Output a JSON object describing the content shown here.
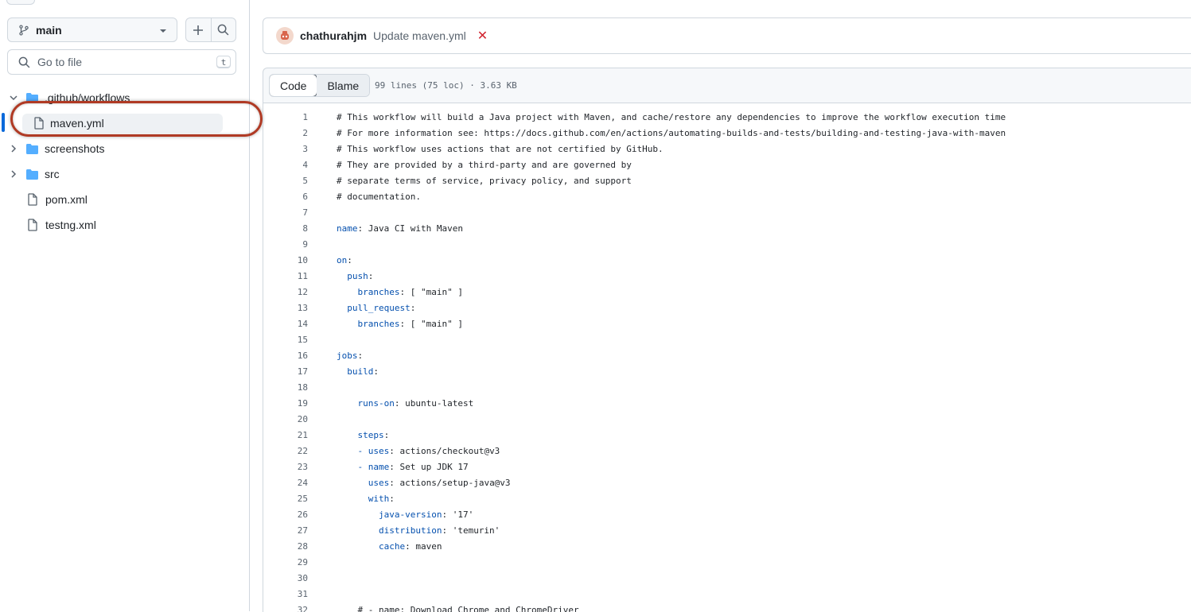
{
  "sidebar": {
    "branch": "main",
    "goto_placeholder": "Go to file",
    "goto_shortcut": "t",
    "tree": [
      {
        "label": ".github/workflows",
        "type": "folder",
        "expanded": true
      },
      {
        "label": "maven.yml",
        "type": "file",
        "selected": true
      },
      {
        "label": "screenshots",
        "type": "folder",
        "expanded": false
      },
      {
        "label": "src",
        "type": "folder",
        "expanded": false
      },
      {
        "label": "pom.xml",
        "type": "file"
      },
      {
        "label": "testng.xml",
        "type": "file"
      }
    ]
  },
  "commit": {
    "author": "chathurahjm",
    "message": "Update maven.yml",
    "status": "failed",
    "status_glyph": "✕"
  },
  "file_header": {
    "tabs": [
      "Code",
      "Blame"
    ],
    "active_tab": "Code",
    "info": "99 lines (75 loc) · 3.63 KB"
  },
  "code": [
    {
      "n": "1",
      "k": "",
      "v": "# This workflow will build a Java project with Maven, and cache/restore any dependencies to improve the workflow execution time"
    },
    {
      "n": "2",
      "k": "",
      "v": "# For more information see: https://docs.github.com/en/actions/automating-builds-and-tests/building-and-testing-java-with-maven"
    },
    {
      "n": "3",
      "k": "",
      "v": "# This workflow uses actions that are not certified by GitHub."
    },
    {
      "n": "4",
      "k": "",
      "v": "# They are provided by a third-party and are governed by"
    },
    {
      "n": "5",
      "k": "",
      "v": "# separate terms of service, privacy policy, and support"
    },
    {
      "n": "6",
      "k": "",
      "v": "# documentation."
    },
    {
      "n": "7",
      "k": "",
      "v": ""
    },
    {
      "n": "8",
      "k": "name",
      "v": ": Java CI with Maven"
    },
    {
      "n": "9",
      "k": "",
      "v": ""
    },
    {
      "n": "10",
      "k": "on",
      "v": ":"
    },
    {
      "n": "11",
      "k": "  push",
      "v": ":"
    },
    {
      "n": "12",
      "k": "    branches",
      "v": ": [ \"main\" ]"
    },
    {
      "n": "13",
      "k": "  pull_request",
      "v": ":"
    },
    {
      "n": "14",
      "k": "    branches",
      "v": ": [ \"main\" ]"
    },
    {
      "n": "15",
      "k": "",
      "v": ""
    },
    {
      "n": "16",
      "k": "jobs",
      "v": ":"
    },
    {
      "n": "17",
      "k": "  build",
      "v": ":"
    },
    {
      "n": "18",
      "k": "",
      "v": ""
    },
    {
      "n": "19",
      "k": "    runs-on",
      "v": ": ubuntu-latest"
    },
    {
      "n": "20",
      "k": "",
      "v": ""
    },
    {
      "n": "21",
      "k": "    steps",
      "v": ":"
    },
    {
      "n": "22",
      "k": "    - uses",
      "v": ": actions/checkout@v3"
    },
    {
      "n": "23",
      "k": "    - name",
      "v": ": Set up JDK 17"
    },
    {
      "n": "24",
      "k": "      uses",
      "v": ": actions/setup-java@v3"
    },
    {
      "n": "25",
      "k": "      with",
      "v": ":"
    },
    {
      "n": "26",
      "k": "        java-version",
      "v": ": '17'"
    },
    {
      "n": "27",
      "k": "        distribution",
      "v": ": 'temurin'"
    },
    {
      "n": "28",
      "k": "        cache",
      "v": ": maven"
    },
    {
      "n": "29",
      "k": "",
      "v": ""
    },
    {
      "n": "30",
      "k": "",
      "v": ""
    },
    {
      "n": "31",
      "k": "",
      "v": ""
    },
    {
      "n": "32",
      "k": "",
      "v": "    # - name: Download Chrome and ChromeDriver"
    }
  ],
  "colors": {
    "accent": "#0969da",
    "folder": "#54aeff",
    "yaml_key": "#0550ae",
    "annotation_ring": "#b03a24",
    "fail": "#d1242f"
  },
  "icons": [
    "git-branch-icon",
    "chevron-down-icon",
    "plus-icon",
    "search-icon",
    "folder-icon",
    "file-icon",
    "chevron-right-icon",
    "avatar",
    "x-icon"
  ]
}
